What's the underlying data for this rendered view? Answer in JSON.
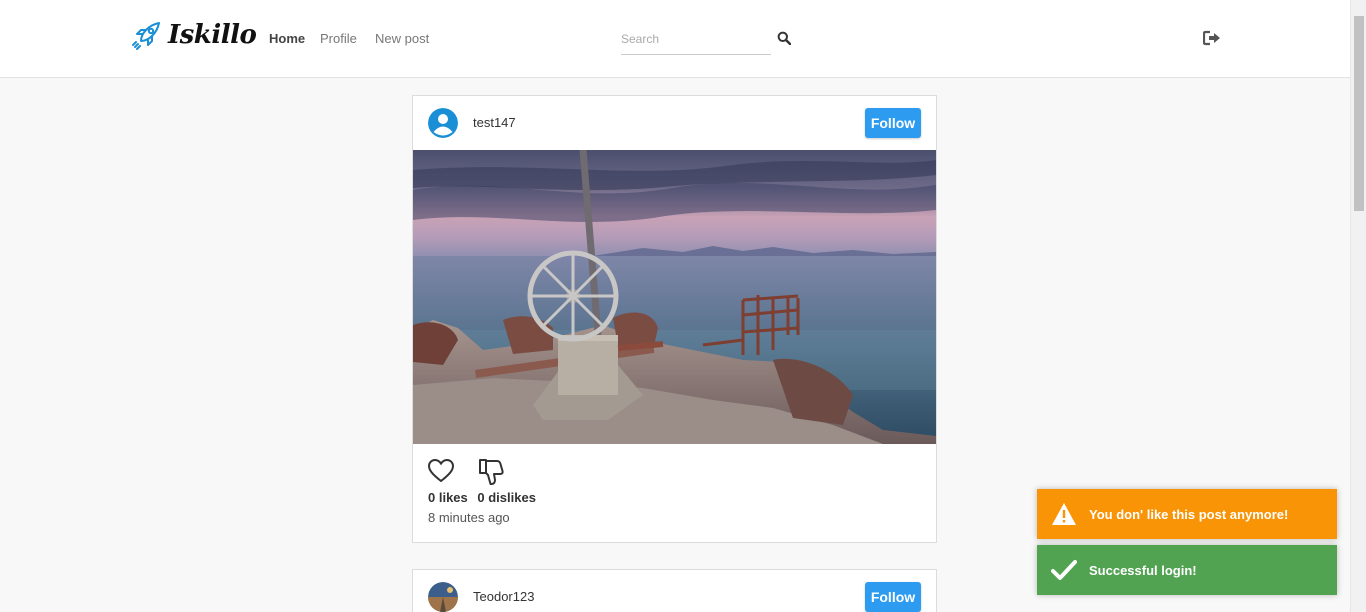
{
  "brand": {
    "name": "Iskillo",
    "logo_icon": "rocket-icon",
    "accent": "#1a8fd6"
  },
  "nav": {
    "home": "Home",
    "profile": "Profile",
    "new_post": "New post"
  },
  "search": {
    "placeholder": "Search",
    "value": ""
  },
  "posts": [
    {
      "username": "test147",
      "follow_label": "Follow",
      "likes": "0 likes",
      "dislikes": "0 dislikes",
      "time": "8 minutes ago"
    },
    {
      "username": "Teodor123",
      "follow_label": "Follow"
    }
  ],
  "toasts": [
    {
      "type": "warning",
      "text": "You don' like this post anymore!",
      "color": "#f89406"
    },
    {
      "type": "success",
      "text": "Successful login!",
      "color": "#51a351"
    }
  ],
  "colors": {
    "follow_button": "#2d9bf0",
    "default_avatar": "#1a8fd6"
  }
}
